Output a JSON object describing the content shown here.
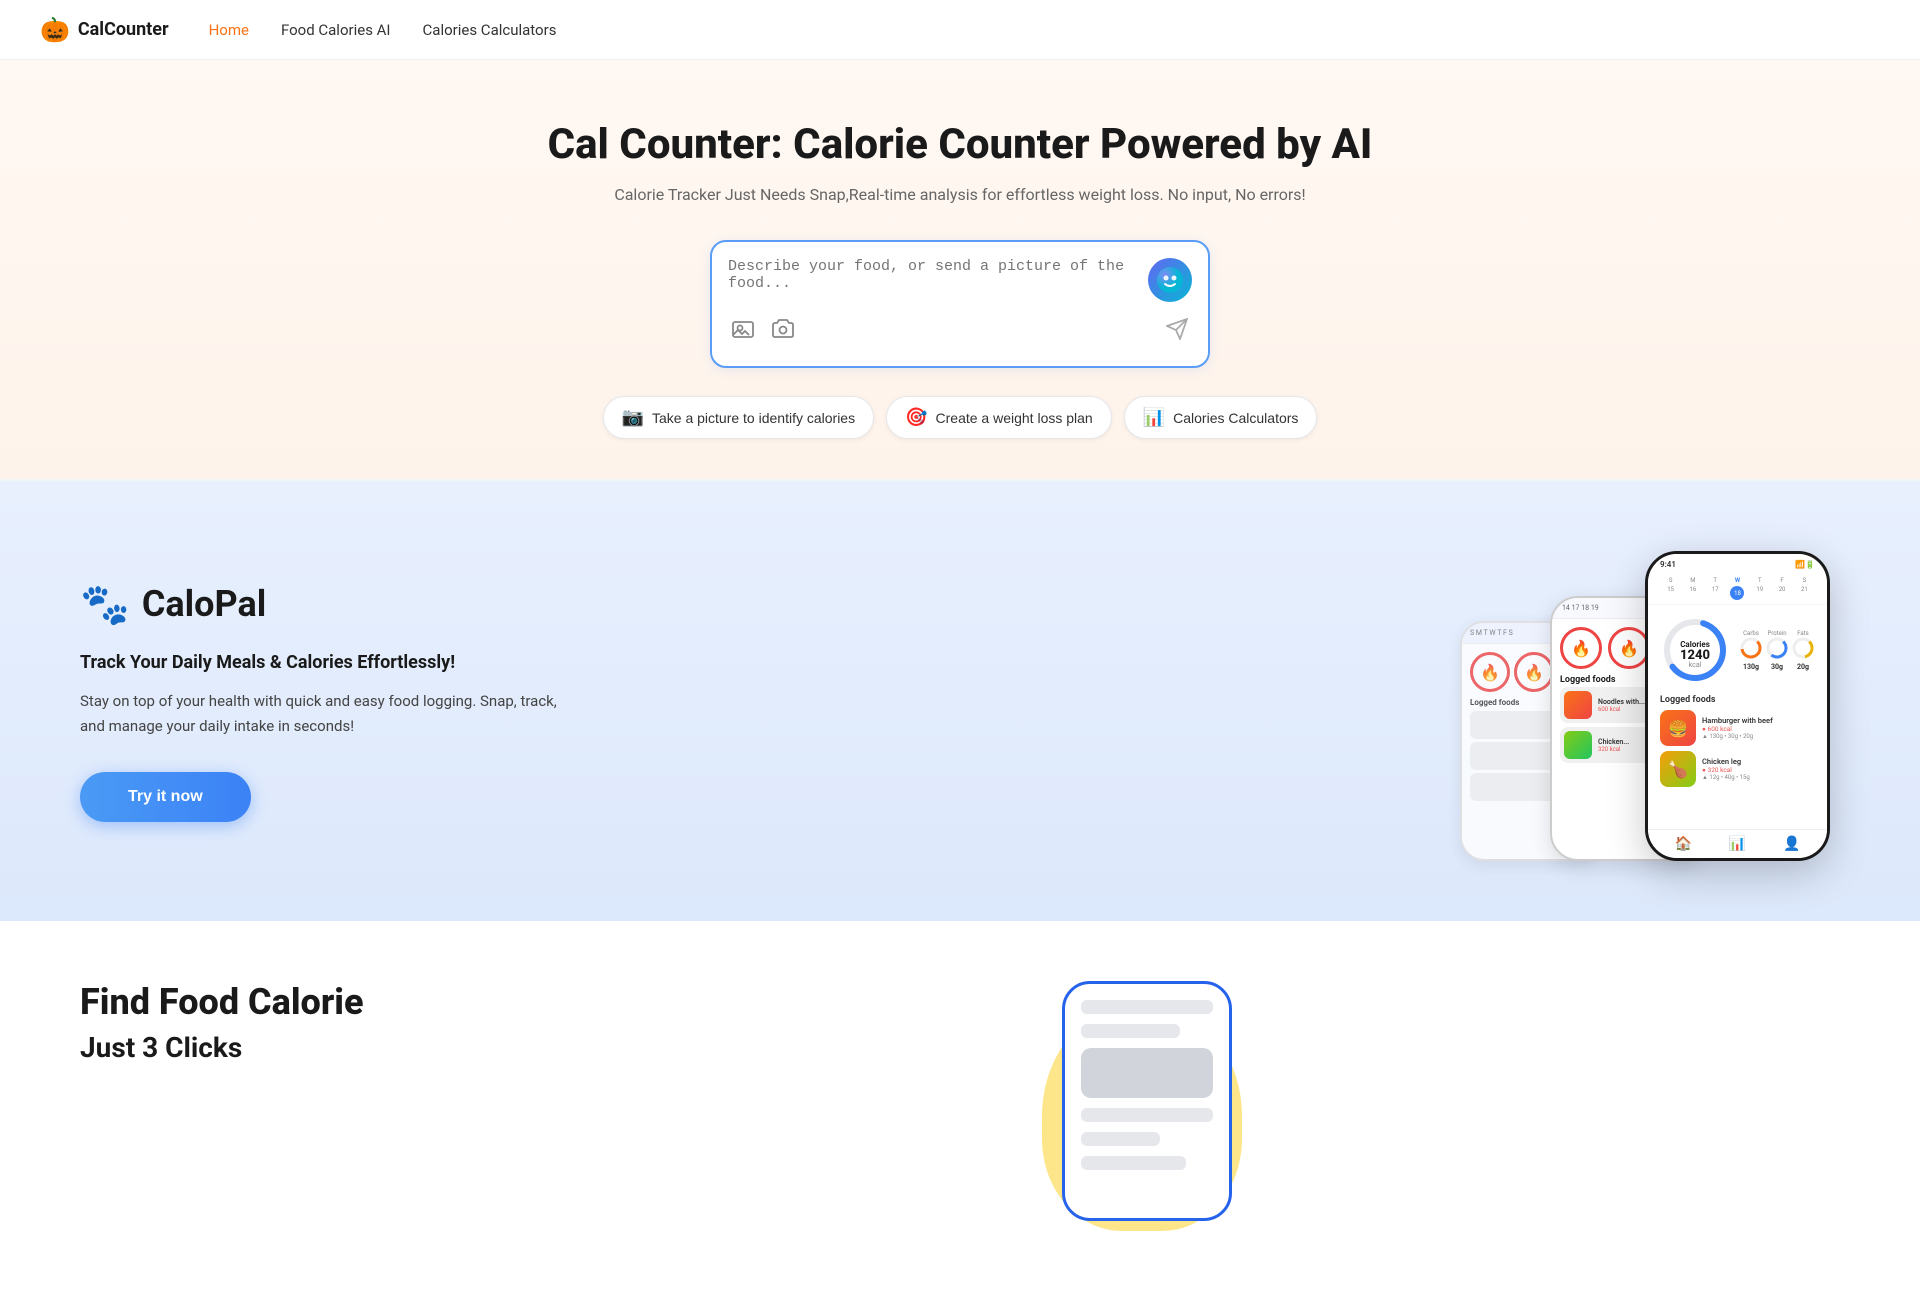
{
  "nav": {
    "logo_icon": "🎃",
    "logo_text": "CalCounter",
    "links": [
      {
        "id": "home",
        "label": "Home",
        "active": true
      },
      {
        "id": "food-calories-ai",
        "label": "Food Calories AI",
        "active": false
      },
      {
        "id": "calories-calculators",
        "label": "Calories Calculators",
        "active": false
      }
    ]
  },
  "hero": {
    "title": "Cal Counter: Calorie Counter Powered by AI",
    "subtitle": "Calorie Tracker Just Needs Snap,Real-time analysis for effortless weight loss. No input, No errors!",
    "search_placeholder": "Describe your food, or send a picture of the food...",
    "ai_avatar": "🤖"
  },
  "quick_actions": [
    {
      "id": "take-picture",
      "icon": "📷",
      "label": "Take a picture to identify calories"
    },
    {
      "id": "weight-loss-plan",
      "icon": "🎯",
      "label": "Create a weight loss plan"
    },
    {
      "id": "calories-calc",
      "icon": "📊",
      "label": "Calories Calculators"
    }
  ],
  "calopal": {
    "brand_icon": "🐾",
    "brand_name": "CaloPal",
    "tagline": "Track Your Daily Meals & Calories Effortlessly!",
    "description": "Stay on top of your health with quick and easy food logging. Snap, track, and manage your daily intake in seconds!",
    "cta_label": "Try it now",
    "phone": {
      "calories": "1,240",
      "calories_unit": "kcal",
      "macros": [
        {
          "name": "Carbs",
          "value": "130g",
          "color": "#f97316"
        },
        {
          "name": "Protein",
          "value": "30g",
          "color": "#3b82f6"
        },
        {
          "name": "Fats",
          "value": "20g",
          "color": "#eab308"
        }
      ],
      "logged_foods": [
        {
          "name": "Hamburger with beef",
          "cal": "600 kcal",
          "macros": "130g • 30g • 20g",
          "color": "#f97316"
        },
        {
          "name": "Chicken leg",
          "cal": "320 kcal",
          "macros": "12g • 40g • 15g",
          "color": "#ef4444"
        }
      ],
      "calendar_days": [
        "S",
        "M",
        "T",
        "W",
        "T",
        "F",
        "S",
        "15",
        "16",
        "17",
        "18",
        "19",
        "20",
        "21"
      ],
      "active_day": "18"
    }
  },
  "find_food": {
    "title": "Find Food Calorie",
    "subtitle": "Just 3 Clicks"
  }
}
